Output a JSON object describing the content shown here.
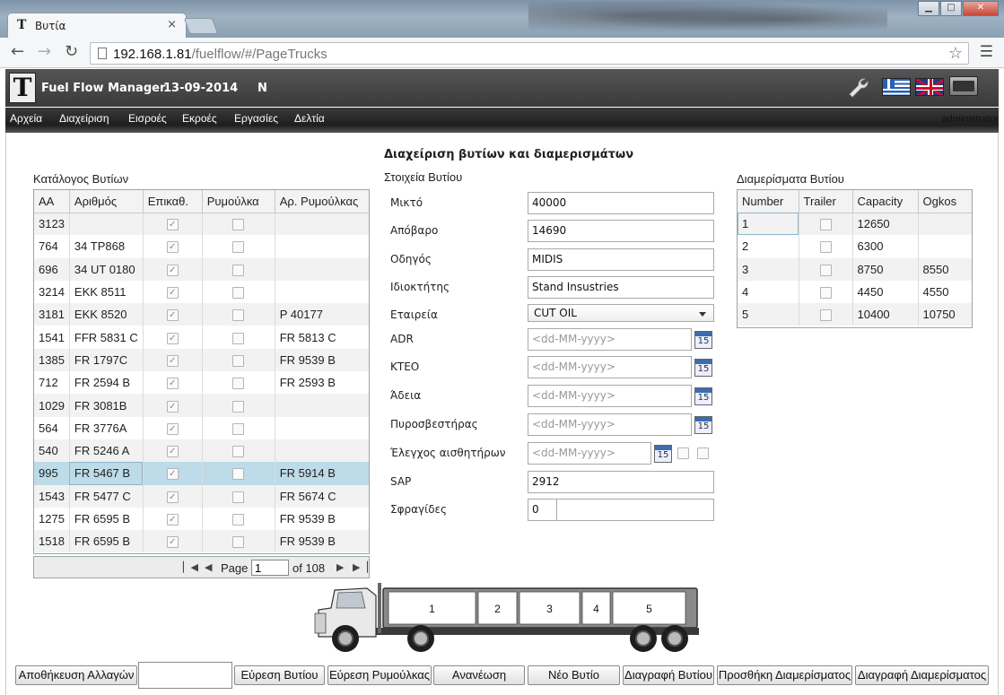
{
  "browser": {
    "tab_title": "Βυτία",
    "tab_close": "×",
    "url_host": "192.168.1.81",
    "url_path": "/fuelflow/#/PageTrucks",
    "window_controls": [
      "▁",
      "□",
      "✕"
    ]
  },
  "header": {
    "logo": "T",
    "app_title": "Fuel Flow Manager",
    "date": "13-09-2014",
    "mode": "N"
  },
  "menu": {
    "items": [
      "Αρχεία",
      "Διαχείριση",
      "Εισροές",
      "Εκροές",
      "Εργασίες",
      "Δελτία"
    ],
    "user": "administrator"
  },
  "page": {
    "title": "Διαχείριση βυτίων και διαμερισμάτων",
    "catalog_label": "Κατάλογος Βυτίων",
    "details_label": "Στοιχεία Βυτίου",
    "compartments_label": "Διαμερίσματα Βυτίου"
  },
  "trucks_table": {
    "headers": [
      "ΑΑ",
      "Αριθμός",
      "Επικαθ.",
      "Ρυμούλκα",
      "Αρ. Ρυμούλκας"
    ],
    "rows": [
      {
        "aa": "3123",
        "number": "",
        "epikath": true,
        "rymoulka": false,
        "ar_rym": ""
      },
      {
        "aa": "764",
        "number": "34 TP868",
        "epikath": true,
        "rymoulka": false,
        "ar_rym": ""
      },
      {
        "aa": "696",
        "number": "34 UT 0180",
        "epikath": true,
        "rymoulka": false,
        "ar_rym": ""
      },
      {
        "aa": "3214",
        "number": "EKK 8511",
        "epikath": true,
        "rymoulka": false,
        "ar_rym": ""
      },
      {
        "aa": "3181",
        "number": "EKK 8520",
        "epikath": true,
        "rymoulka": false,
        "ar_rym": "P 40177"
      },
      {
        "aa": "1541",
        "number": "FFR 5831 C",
        "epikath": true,
        "rymoulka": false,
        "ar_rym": "FR 5813 C"
      },
      {
        "aa": "1385",
        "number": "FR 1797C",
        "epikath": true,
        "rymoulka": false,
        "ar_rym": "FR 9539 B"
      },
      {
        "aa": "712",
        "number": "FR 2594  B",
        "epikath": true,
        "rymoulka": false,
        "ar_rym": "FR 2593 B"
      },
      {
        "aa": "1029",
        "number": "FR 3081B",
        "epikath": true,
        "rymoulka": false,
        "ar_rym": ""
      },
      {
        "aa": "564",
        "number": "FR 3776A",
        "epikath": true,
        "rymoulka": false,
        "ar_rym": ""
      },
      {
        "aa": "540",
        "number": "FR 5246 A",
        "epikath": true,
        "rymoulka": false,
        "ar_rym": ""
      },
      {
        "aa": "995",
        "number": "FR 5467 B",
        "epikath": true,
        "rymoulka": false,
        "ar_rym": "FR 5914 B"
      },
      {
        "aa": "1543",
        "number": "FR 5477 C",
        "epikath": true,
        "rymoulka": false,
        "ar_rym": "FR 5674 C"
      },
      {
        "aa": "1275",
        "number": "FR 6595 B",
        "epikath": true,
        "rymoulka": false,
        "ar_rym": "FR 9539 B"
      },
      {
        "aa": "1518",
        "number": "FR 6595 B",
        "epikath": true,
        "rymoulka": false,
        "ar_rym": "FR 9539 B"
      }
    ],
    "selected_index": 11
  },
  "pager": {
    "page_label": "Page",
    "current_page": "1",
    "of_label": "of 108"
  },
  "form": {
    "fields": [
      {
        "label": "Μικτό",
        "value": "40000"
      },
      {
        "label": "Απόβαρο",
        "value": "14690"
      },
      {
        "label": "Οδηγός",
        "value": "MIDIS"
      },
      {
        "label": "Ιδιοκτήτης",
        "value": "Stand Insustries"
      },
      {
        "label": "Εταιρεία",
        "value": "CUT OIL"
      },
      {
        "label": "ADR",
        "placeholder": "<dd-MM-yyyy>"
      },
      {
        "label": "ΚΤΕΟ",
        "placeholder": "<dd-MM-yyyy>"
      },
      {
        "label": "Άδεια",
        "placeholder": "<dd-MM-yyyy>"
      },
      {
        "label": "Πυροσβεστήρας",
        "placeholder": "<dd-MM-yyyy>"
      },
      {
        "label": "Έλεγχος αισθητήρων",
        "placeholder": "<dd-MM-yyyy>"
      },
      {
        "label": "SAP",
        "value": "2912"
      },
      {
        "label": "Σφραγίδες",
        "value": "0"
      }
    ],
    "calendar_day": "15"
  },
  "compartments_table": {
    "headers": [
      "Number",
      "Trailer",
      "Capacity",
      "Ogkos"
    ],
    "rows": [
      {
        "number": "1",
        "trailer": false,
        "capacity": "12650",
        "ogkos": ""
      },
      {
        "number": "2",
        "trailer": false,
        "capacity": "6300",
        "ogkos": ""
      },
      {
        "number": "3",
        "trailer": false,
        "capacity": "8750",
        "ogkos": "8550"
      },
      {
        "number": "4",
        "trailer": false,
        "capacity": "4450",
        "ogkos": "4550"
      },
      {
        "number": "5",
        "trailer": false,
        "capacity": "10400",
        "ogkos": "10750"
      }
    ]
  },
  "truck_compartments": [
    "1",
    "2",
    "3",
    "4",
    "5"
  ],
  "buttons": {
    "save": "Αποθήκευση Αλλαγών",
    "find_truck": "Εύρεση Βυτίου",
    "find_trailer": "Εύρεση Ρυμούλκας",
    "refresh": "Ανανέωση",
    "new_truck": "Νέο Βυτίο",
    "delete_truck": "Διαγραφή Βυτίου",
    "add_compartment": "Προσθήκη Διαμερίσματος",
    "delete_compartment": "Διαγραφή Διαμερίσματος"
  },
  "colors": {
    "selected_row": "#bddbe8",
    "header_bar": "#3a3a3a"
  }
}
